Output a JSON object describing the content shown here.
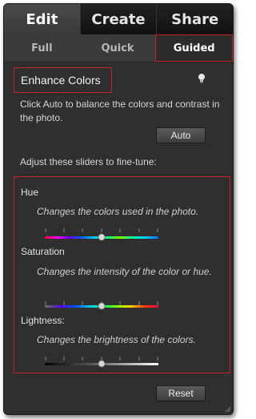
{
  "mode_tabs": [
    {
      "label": "Edit",
      "active": true
    },
    {
      "label": "Create",
      "active": false
    },
    {
      "label": "Share",
      "active": false
    }
  ],
  "sub_tabs": [
    {
      "label": "Full",
      "active": false
    },
    {
      "label": "Quick",
      "active": false
    },
    {
      "label": "Guided",
      "active": true
    }
  ],
  "panel": {
    "title": "Enhance Colors",
    "hint_icon": "lightbulb-icon",
    "description": "Click Auto to balance the colors and contrast in the photo.",
    "auto_label": "Auto",
    "adjust_label": "Adjust these sliders to fine-tune:",
    "reset_label": "Reset"
  },
  "sliders": [
    {
      "label": "Hue",
      "description": "Changes the colors used in the photo.",
      "value": 0.5,
      "track": "hue"
    },
    {
      "label": "Saturation",
      "description": "Changes the intensity of the color or hue.",
      "value": 0.5,
      "track": "saturation"
    },
    {
      "label": "Lightness:",
      "description": "Changes the brightness of the colors.",
      "value": 0.5,
      "track": "lightness"
    }
  ],
  "colors": {
    "highlight": "#c0272d",
    "panel_bg": "#2f2f2f"
  }
}
